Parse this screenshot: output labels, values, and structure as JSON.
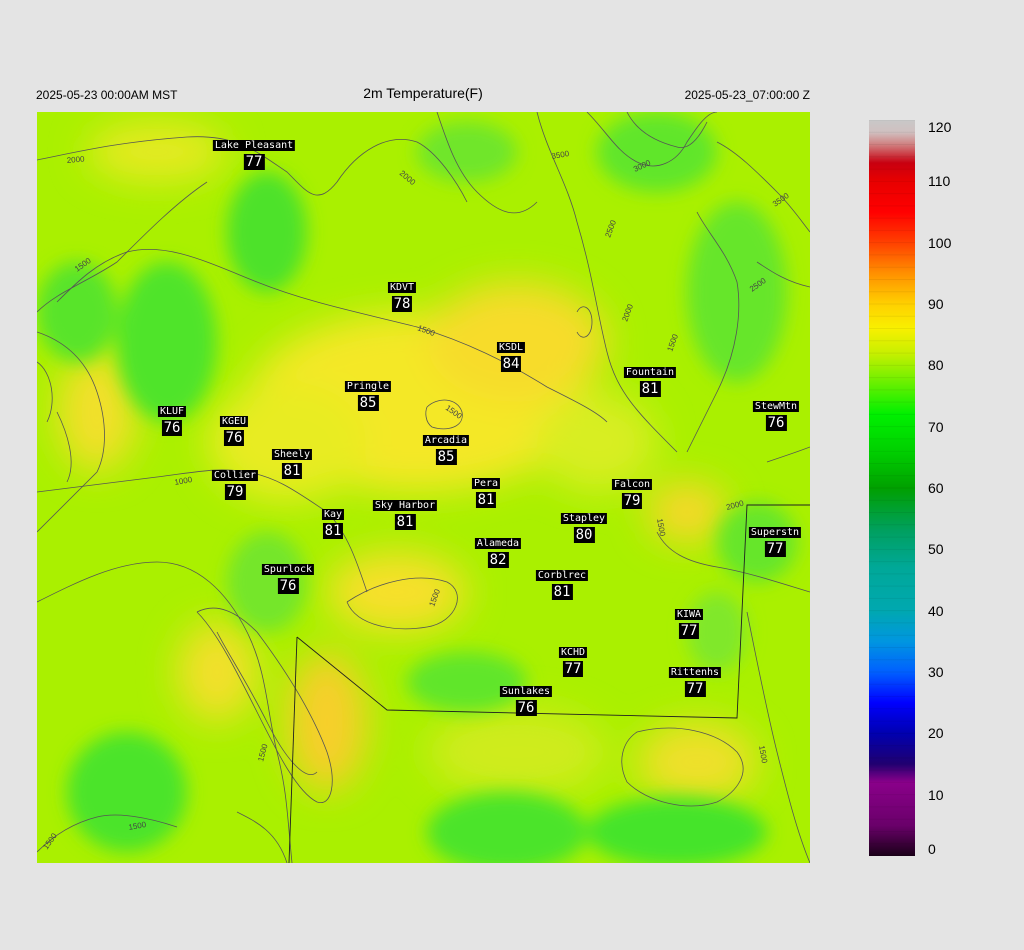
{
  "header": {
    "left": "2025-05-23 00:00AM MST",
    "title": "2m Temperature(F)",
    "right": "2025-05-23_07:00:00 Z"
  },
  "colors": {
    "page_background": "#e4e4e4",
    "base_field": "#aaf000",
    "warm_field": "#f6e82a",
    "cool_field": "#4fe82a",
    "contour": "#555555",
    "label_bg": "#000000",
    "label_fg": "#ffffff"
  },
  "contour_labels": [
    "2000",
    "2000",
    "3500",
    "3000",
    "3500",
    "2500",
    "2500",
    "2000",
    "1500",
    "1500",
    "1500",
    "1500",
    "1000",
    "2000",
    "1500",
    "1500",
    "1500",
    "1500",
    "1500",
    "1500"
  ],
  "stations": [
    {
      "name": "Lake Pleasant",
      "temp": "77"
    },
    {
      "name": "KDVT",
      "temp": "78"
    },
    {
      "name": "KSDL",
      "temp": "84"
    },
    {
      "name": "Fountain",
      "temp": "81"
    },
    {
      "name": "StewMtn",
      "temp": "76"
    },
    {
      "name": "KLUF",
      "temp": "76"
    },
    {
      "name": "KGEU",
      "temp": "76"
    },
    {
      "name": "Pringle",
      "temp": "85"
    },
    {
      "name": "Arcadia",
      "temp": "85"
    },
    {
      "name": "Sheely",
      "temp": "81"
    },
    {
      "name": "Collier",
      "temp": "79"
    },
    {
      "name": "Pera",
      "temp": "81"
    },
    {
      "name": "Falcon",
      "temp": "79"
    },
    {
      "name": "Kay",
      "temp": "81"
    },
    {
      "name": "Sky Harbor",
      "temp": "81"
    },
    {
      "name": "Stapley",
      "temp": "80"
    },
    {
      "name": "Superstn",
      "temp": "77"
    },
    {
      "name": "Alameda",
      "temp": "82"
    },
    {
      "name": "Spurlock",
      "temp": "76"
    },
    {
      "name": "Corblrec",
      "temp": "81"
    },
    {
      "name": "KIWA",
      "temp": "77"
    },
    {
      "name": "KCHD",
      "temp": "77"
    },
    {
      "name": "Rittenhs",
      "temp": "77"
    },
    {
      "name": "Sunlakes",
      "temp": "76"
    }
  ],
  "colorbar": {
    "min": 0,
    "max": 120,
    "ticks": [
      "120",
      "110",
      "100",
      "90",
      "80",
      "70",
      "60",
      "50",
      "40",
      "30",
      "20",
      "10",
      "0"
    ],
    "stops": [
      {
        "value": 0,
        "color": "#1a0018"
      },
      {
        "value": 5,
        "color": "#6a006a"
      },
      {
        "value": 12,
        "color": "#8a008a"
      },
      {
        "value": 15,
        "color": "#200070"
      },
      {
        "value": 20,
        "color": "#0000b0"
      },
      {
        "value": 25,
        "color": "#0000ff"
      },
      {
        "value": 30,
        "color": "#0060ff"
      },
      {
        "value": 35,
        "color": "#0096e0"
      },
      {
        "value": 40,
        "color": "#00a8b0"
      },
      {
        "value": 47,
        "color": "#00a898"
      },
      {
        "value": 53,
        "color": "#00a060"
      },
      {
        "value": 60,
        "color": "#00a000"
      },
      {
        "value": 66,
        "color": "#00d000"
      },
      {
        "value": 72,
        "color": "#00f000"
      },
      {
        "value": 77,
        "color": "#66f000"
      },
      {
        "value": 82,
        "color": "#c8f000"
      },
      {
        "value": 86,
        "color": "#f8f000"
      },
      {
        "value": 90,
        "color": "#ffd000"
      },
      {
        "value": 95,
        "color": "#ff9000"
      },
      {
        "value": 100,
        "color": "#ff4000"
      },
      {
        "value": 105,
        "color": "#ff0000"
      },
      {
        "value": 110,
        "color": "#e80000"
      },
      {
        "value": 113,
        "color": "#c80010"
      },
      {
        "value": 116,
        "color": "#d08080"
      },
      {
        "value": 118,
        "color": "#d0c0c0"
      },
      {
        "value": 120,
        "color": "#c8c8c8"
      }
    ]
  }
}
